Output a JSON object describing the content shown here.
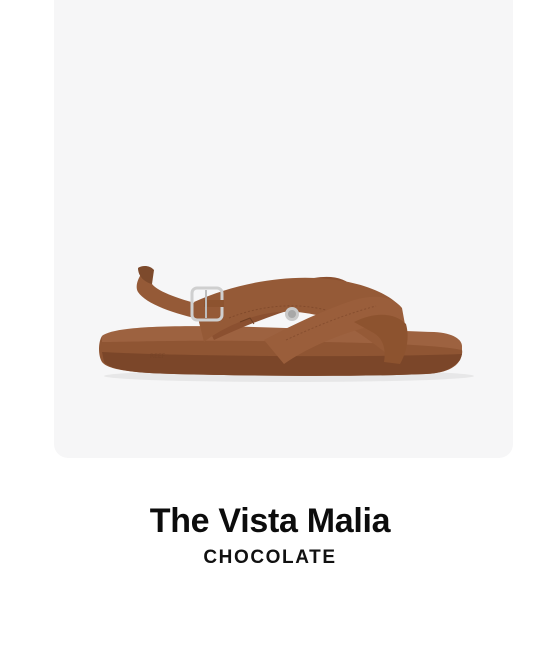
{
  "product": {
    "name": "The Vista Malia",
    "color": "CHOCOLATE",
    "image_icon": "sandal-product-image",
    "background_color": "#f6f6f7",
    "leather_color": "#8f5533"
  }
}
